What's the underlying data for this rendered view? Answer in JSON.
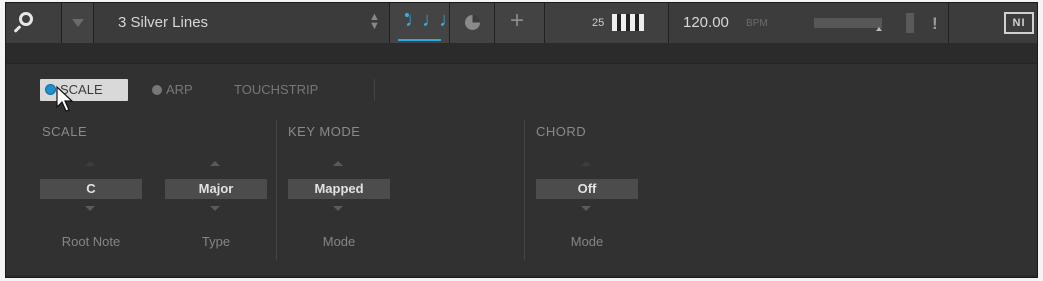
{
  "header": {
    "preset_name": "3 Silver Lines",
    "keyboard_octave": "25",
    "tempo_value": "120.00",
    "tempo_unit": "BPM",
    "warning": "!",
    "logo_text": "NI",
    "perform_icon": "♩♩♩",
    "add_icon": "+"
  },
  "tabs": [
    {
      "label": "SCALE",
      "active": true
    },
    {
      "label": "ARP",
      "active": false
    },
    {
      "label": "TOUCHSTRIP",
      "active": false
    }
  ],
  "scale_section": {
    "title": "SCALE",
    "params": [
      {
        "value": "C",
        "label": "Root Note"
      },
      {
        "value": "Major",
        "label": "Type"
      }
    ]
  },
  "keymode_section": {
    "title": "KEY MODE",
    "params": [
      {
        "value": "Mapped",
        "label": "Mode"
      }
    ]
  },
  "chord_section": {
    "title": "CHORD",
    "params": [
      {
        "value": "Off",
        "label": "Mode"
      }
    ]
  },
  "colors": {
    "accent": "#2fa9e4",
    "led_active": "#1f8fcf"
  }
}
